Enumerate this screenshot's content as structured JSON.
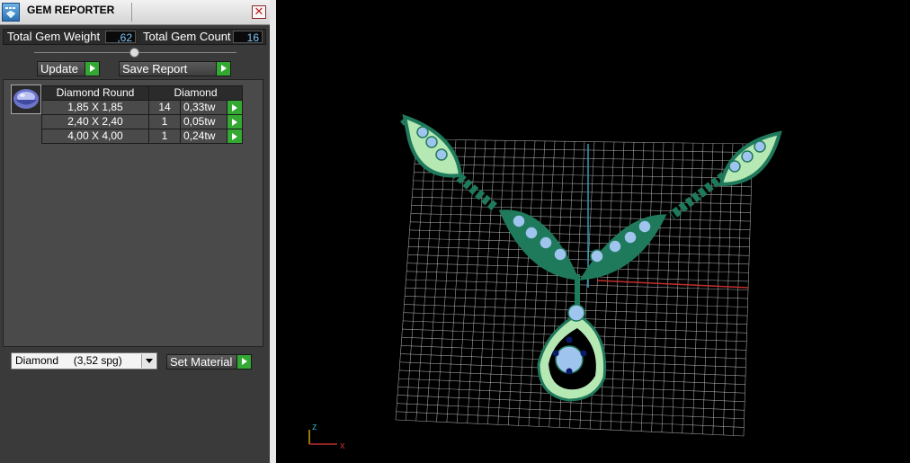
{
  "window": {
    "title": "GEM REPORTER",
    "close_label": "✕"
  },
  "totals": {
    "weight_label": "Total Gem Weight",
    "weight_value": ",62",
    "count_label": "Total Gem Count",
    "count_value": "16"
  },
  "actions": {
    "update_label": "Update",
    "save_report_label": "Save Report"
  },
  "report": {
    "thumbnail_icon": "gem-round-icon",
    "headers": [
      "Diamond Round",
      "Diamond"
    ],
    "rows": [
      {
        "size": "1,85 X 1,85",
        "count": "14",
        "weight": "0,33tw"
      },
      {
        "size": "2,40 X 2,40",
        "count": "1",
        "weight": "0,05tw"
      },
      {
        "size": "4,00 X 4,00",
        "count": "1",
        "weight": "0,24tw"
      }
    ]
  },
  "material": {
    "selected": "Diamond     (3,52 spg)",
    "set_label": "Set Material"
  },
  "viewport": {
    "axes": {
      "z": "z",
      "x": "x"
    },
    "colors": {
      "background": "#000000",
      "grid": "#cfcfcf",
      "metal": "#1f7a5c",
      "metal_light": "#b6e8b4",
      "gem": "#9fc4ee",
      "prong": "#0a1a6a",
      "axis_x": "#c0302c",
      "axis_y": "#2aa0b8"
    }
  }
}
